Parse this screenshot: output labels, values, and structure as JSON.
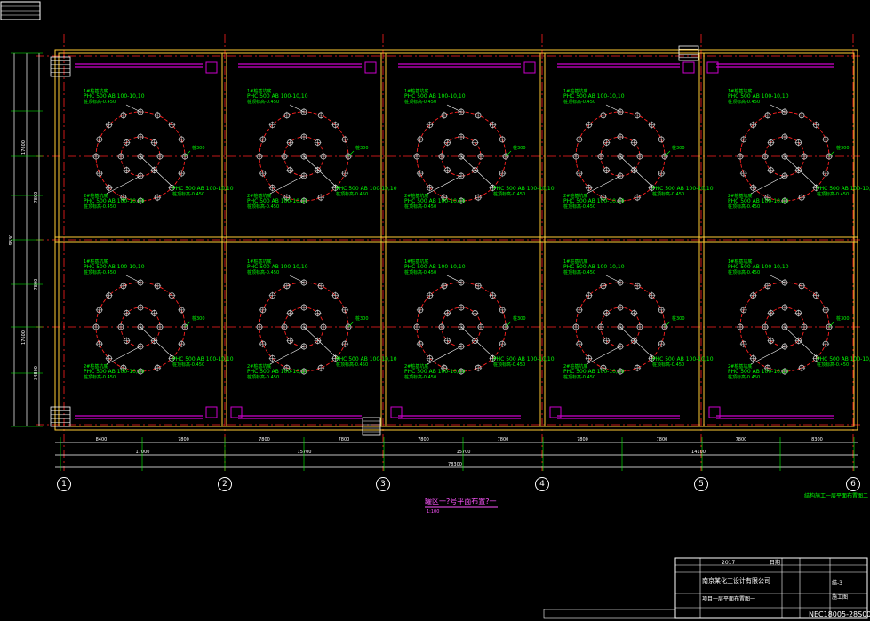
{
  "colors": {
    "background": "#000000",
    "grid_axis": "#ff2020",
    "wall": "#ffcc33",
    "pile_ring": "#ff2020",
    "pile": "#c8c8c8",
    "annotation": "#00ff00",
    "drain": "#cc00cc",
    "dimension": "#ffffff",
    "frame": "#ffffff"
  },
  "axis_labels": [
    "1",
    "2",
    "3",
    "4",
    "5",
    "6"
  ],
  "dimensions": {
    "bottom_segments": [
      "8400",
      "7800",
      "7800",
      "7800",
      "7800",
      "7800",
      "7800",
      "7800",
      "7800",
      "8300"
    ],
    "bottom_totals": [
      "17000",
      "15700",
      "15700",
      "14100"
    ],
    "bottom_overall": "78300",
    "left": [
      "17600",
      "7800",
      "9830",
      "7800",
      "17600",
      "34800"
    ]
  },
  "pile_notes": {
    "top_note_line1": "1#桩基坑底",
    "top_note_line2": "PHC 500 AB 100-10,10",
    "top_note_line3": "桩顶标高-0.450",
    "bottom_note_line1": "2#桩基坑底",
    "bottom_note_line2": "PHC 500 AB 100-10,10",
    "bottom_note_line3": "桩顶标高-0.450",
    "side_label": "桩300"
  },
  "drawing_title": "罐区一?号平面布置?一",
  "drawing_subtitle": "1:100",
  "side_note": "结构施工一层平面布置图二",
  "title_block": {
    "company": "南京某化工设计有限公司",
    "project": "项目一层平面布置图一",
    "drawing_no": "NEC18005-28S00",
    "stage": "施工图",
    "sheet": "结-3",
    "year": "2017",
    "date_label": "日期"
  }
}
